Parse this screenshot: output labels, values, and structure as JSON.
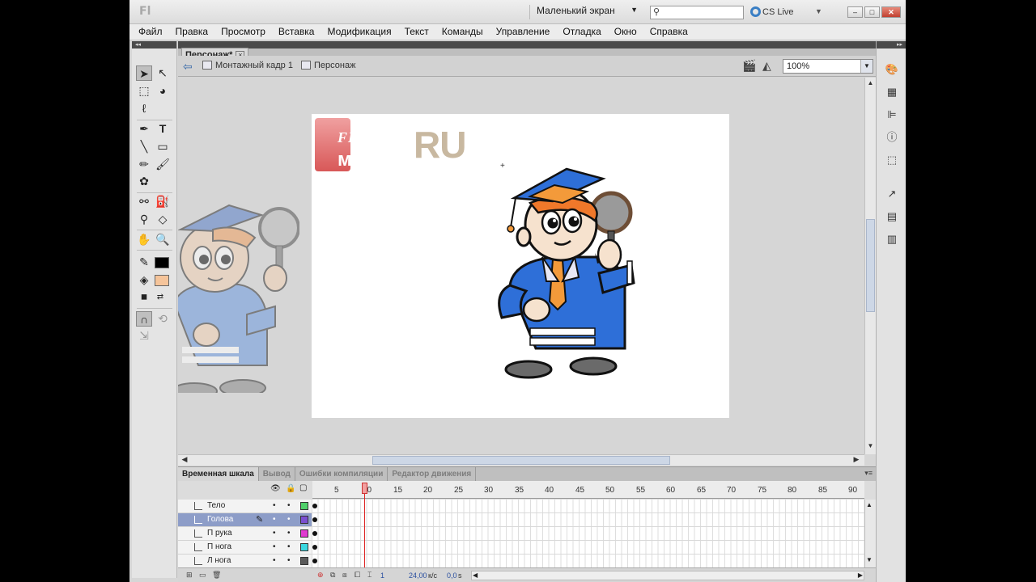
{
  "app": {
    "logo": "Fl",
    "workspace": "Маленький экран",
    "search_placeholder": "",
    "cs_live": "CS Live",
    "window_buttons": [
      "–",
      "□",
      "✕"
    ]
  },
  "menu": [
    "Файл",
    "Правка",
    "Просмотр",
    "Вставка",
    "Модификация",
    "Текст",
    "Команды",
    "Управление",
    "Отладка",
    "Окно",
    "Справка"
  ],
  "document": {
    "tab_label": "Персонаж*",
    "tab_close": "×"
  },
  "editbar": {
    "scene": "Монтажный кадр 1",
    "symbol": "Персонаж",
    "zoom": "100%"
  },
  "stage_logo": {
    "flash": "FLASH",
    "master": "масте",
    "ru": "RU"
  },
  "timeline": {
    "tabs": [
      "Временная шкала",
      "Вывод",
      "Ошибки компиляции",
      "Редактор движения"
    ],
    "ruler": [
      "5",
      "10",
      "15",
      "20",
      "25",
      "30",
      "35",
      "40",
      "45",
      "50",
      "55",
      "60",
      "65",
      "70",
      "75",
      "80",
      "85",
      "90"
    ],
    "layers": [
      {
        "name": "Тело",
        "color": "#4fd06a",
        "selected": false
      },
      {
        "name": "Голова",
        "color": "#7a4fd0",
        "selected": true
      },
      {
        "name": "П рука",
        "color": "#e03ad0",
        "selected": false
      },
      {
        "name": "П нога",
        "color": "#3ad8e0",
        "selected": false
      },
      {
        "name": "Л нога",
        "color": "#5a5a5a",
        "selected": false
      }
    ],
    "footer": {
      "frame": "1",
      "fps": "24,00",
      "fps_unit": "к/с",
      "time": "0,0",
      "time_unit": "s"
    }
  },
  "colors": {
    "stroke": "#000000",
    "fill": "#f5c49a",
    "accent": "#3568a8"
  }
}
